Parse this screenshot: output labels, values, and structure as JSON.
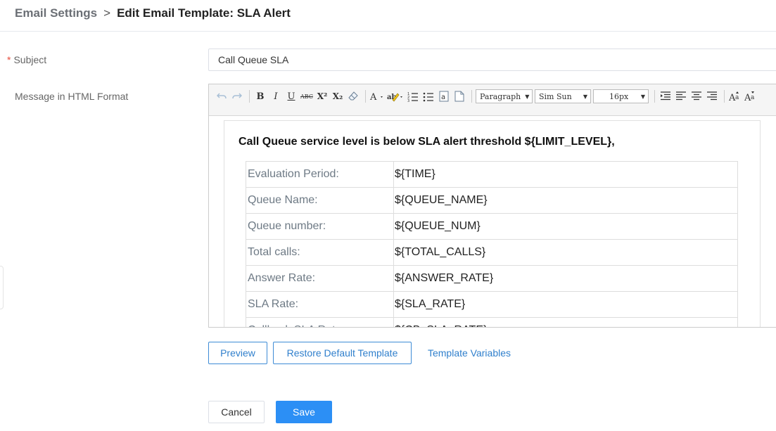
{
  "breadcrumb": {
    "parent": "Email Settings",
    "separator": ">",
    "current": "Edit Email Template: SLA Alert"
  },
  "form": {
    "subject": {
      "required_mark": "*",
      "label": "Subject",
      "value": "Call Queue SLA"
    },
    "message": {
      "label": "Message in HTML Format"
    }
  },
  "editor": {
    "toolbar": {
      "undo_icon": "undo-icon",
      "redo_icon": "redo-icon",
      "bold": "B",
      "italic": "I",
      "underline": "U",
      "strikethrough": "ABC",
      "superscript": "X²",
      "subscript": "X₂",
      "format_dropdown": "Paragraph",
      "font_dropdown": "Sim Sun",
      "size_dropdown": "16px"
    },
    "content": {
      "heading": "Call Queue service level is below SLA alert threshold ${LIMIT_LEVEL},",
      "rows": [
        {
          "key": "Evaluation Period:",
          "value": "${TIME}"
        },
        {
          "key": "Queue Name:",
          "value": "${QUEUE_NAME}"
        },
        {
          "key": "Queue number:",
          "value": "${QUEUE_NUM}"
        },
        {
          "key": "Total calls:",
          "value": "${TOTAL_CALLS}"
        },
        {
          "key": "Answer Rate:",
          "value": "${ANSWER_RATE}"
        },
        {
          "key": "SLA Rate:",
          "value": "${SLA_RATE}"
        },
        {
          "key": "Callback SLA Rate:",
          "value": "${CB_SLA_RATE}"
        }
      ]
    }
  },
  "actions": {
    "preview": "Preview",
    "restore": "Restore Default Template",
    "variables": "Template Variables",
    "cancel": "Cancel",
    "save": "Save"
  },
  "colors": {
    "primary": "#2c8ff5",
    "link": "#2f7fcc",
    "required": "#e74c3c"
  }
}
